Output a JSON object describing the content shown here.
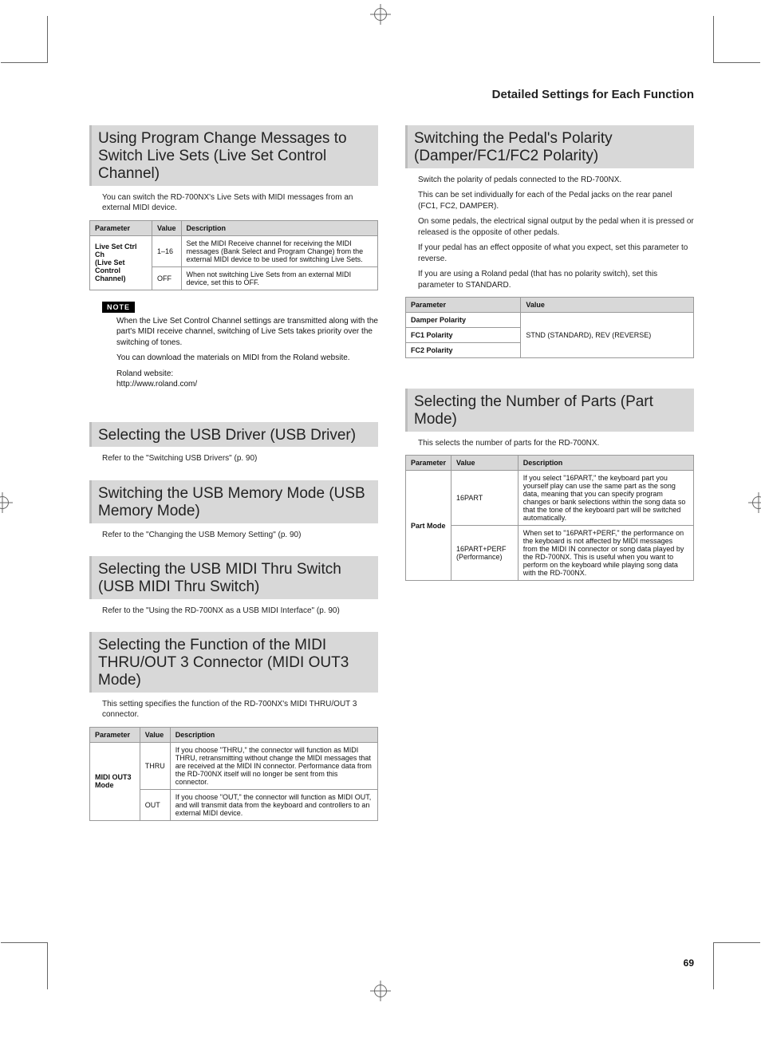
{
  "header": "Detailed Settings for Each Function",
  "page_number": "69",
  "left": {
    "s1": {
      "title": "Using Program Change Messages to Switch Live Sets (Live Set Control Channel)",
      "p1": "You can switch the RD-700NX's Live Sets with MIDI messages from an external MIDI device.",
      "table": {
        "h1": "Parameter",
        "h2": "Value",
        "h3": "Description",
        "r1c1": "Live Set Ctrl Ch\n(Live Set Control Channel)",
        "r1c2a": "1–16",
        "r1c3a": "Set the MIDI Receive channel for receiving the MIDI messages (Bank Select and Program Change) from the external MIDI device to be used for switching Live Sets.",
        "r1c2b": "OFF",
        "r1c3b": "When not switching Live Sets from an external MIDI device, set this to OFF."
      },
      "note_label": "NOTE",
      "note1": "When the Live Set Control Channel settings are transmitted along with the part's MIDI receive channel, switching of Live Sets takes priority over the switching of tones.",
      "note2": "You can download the materials on MIDI from the Roland website.",
      "note3a": "Roland website:",
      "note3b": "http://www.roland.com/"
    },
    "s2": {
      "title": "Selecting the USB Driver (USB Driver)",
      "p1": "Refer to the \"Switching USB Drivers\" (p. 90)"
    },
    "s3": {
      "title": "Switching the USB Memory Mode (USB Memory Mode)",
      "p1": "Refer to the \"Changing the USB Memory Setting\" (p. 90)"
    },
    "s4": {
      "title": "Selecting the USB MIDI Thru Switch (USB MIDI Thru Switch)",
      "p1": "Refer to the \"Using the RD-700NX as a USB MIDI Interface\" (p. 90)"
    },
    "s5": {
      "title": "Selecting the Function of the MIDI THRU/OUT 3 Connector (MIDI OUT3 Mode)",
      "p1": "This setting specifies the function of the RD-700NX's MIDI THRU/OUT 3 connector.",
      "table": {
        "h1": "Parameter",
        "h2": "Value",
        "h3": "Description",
        "r1c1": "MIDI OUT3 Mode",
        "r1c2a": "THRU",
        "r1c3a": "If you choose \"THRU,\" the connector will function as MIDI THRU, retransmitting without change the MIDI messages that are received at the MIDI IN connector. Performance data from the RD-700NX itself will no longer be sent from this connector.",
        "r1c2b": "OUT",
        "r1c3b": "If you choose \"OUT,\" the connector will function as MIDI OUT, and will transmit data from the keyboard and controllers to an external MIDI device."
      }
    }
  },
  "right": {
    "s1": {
      "title": "Switching the Pedal's Polarity (Damper/FC1/FC2 Polarity)",
      "p1": "Switch the polarity of pedals connected to the RD-700NX.",
      "p2": "This can be set individually for each of the Pedal jacks on the rear panel (FC1, FC2, DAMPER).",
      "p3": "On some pedals, the electrical signal output by the pedal when it is pressed or released is the opposite of other pedals.",
      "p4": "If your pedal has an effect opposite of what you expect, set this parameter to reverse.",
      "p5": "If you are using a Roland pedal (that has no polarity switch), set this parameter to STANDARD.",
      "table": {
        "h1": "Parameter",
        "h2": "Value",
        "r1": "Damper Polarity",
        "r2": "FC1 Polarity",
        "r3": "FC2 Polarity",
        "v": "STND (STANDARD), REV (REVERSE)"
      }
    },
    "s2": {
      "title": "Selecting the Number of Parts (Part Mode)",
      "p1": "This selects the number of parts for the RD-700NX.",
      "table": {
        "h1": "Parameter",
        "h2": "Value",
        "h3": "Description",
        "r1c1": "Part Mode",
        "r1c2a": "16PART",
        "r1c3a": "If you select \"16PART,\" the keyboard part you yourself play can use the same part as the song data, meaning that you can specify program changes or bank selections within the song data so that the tone of the keyboard part will be switched automatically.",
        "r1c2b": "16PART+PERF (Performance)",
        "r1c3b": "When set to \"16PART+PERF,\" the performance on the keyboard is not affected by MIDI messages from the MIDI IN connector or song data played by the RD-700NX. This is useful when you want to perform on the keyboard while playing song data with the RD-700NX."
      }
    }
  }
}
